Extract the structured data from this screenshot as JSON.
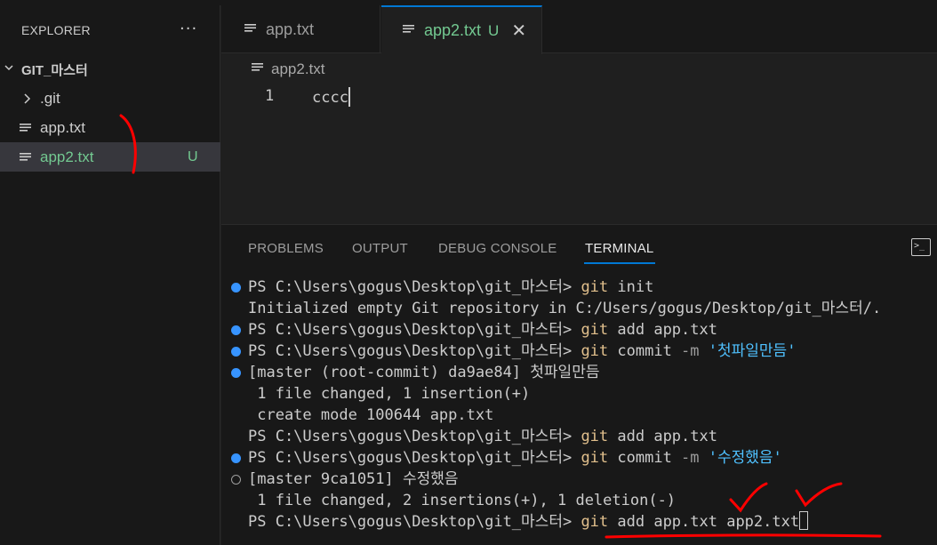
{
  "sidebar": {
    "title": "EXPLORER",
    "more_icon": "ellipsis-icon",
    "folder": "GIT_마스터",
    "items": [
      {
        "label": ".git",
        "icon": "chevron-right-icon"
      },
      {
        "label": "app.txt",
        "icon": "file-lines-icon"
      },
      {
        "label": "app2.txt",
        "icon": "file-lines-icon",
        "badge": "U"
      }
    ]
  },
  "tabs": [
    {
      "label": "app.txt"
    },
    {
      "label": "app2.txt",
      "badge": "U",
      "close": "✕"
    }
  ],
  "editor": {
    "breadcrumb": "app2.txt",
    "lines": [
      {
        "num": "1",
        "text": "cccc"
      }
    ]
  },
  "panel": {
    "tabs": [
      "PROBLEMS",
      "OUTPUT",
      "DEBUG CONSOLE",
      "TERMINAL"
    ],
    "active_tab": "TERMINAL"
  },
  "terminal": {
    "prompt": "PS C:\\Users\\gogus\\Desktop\\git_마스터> ",
    "l1_cmd": "git",
    "l1_args": " init",
    "l2": "Initialized empty Git repository in C:/Users/gogus/Desktop/git_마스터/.",
    "l3_cmd": "git",
    "l3_args": " add app.txt",
    "l4_cmd": "git",
    "l4_args": " commit ",
    "l4_flag": "-m",
    "l4_str": " '첫파일만듬'",
    "l5": "[master (root-commit) da9ae84] 첫파일만듬",
    "l6": " 1 file changed, 1 insertion(+)",
    "l7": " create mode 100644 app.txt",
    "l8_cmd": "git",
    "l8_args": " add app.txt",
    "l9_cmd": "git",
    "l9_args": " commit ",
    "l9_flag": "-m",
    "l9_str": " '수정했음'",
    "l10": "[master 9ca1051] 수정했음",
    "l11": " 1 file changed, 2 insertions(+), 1 deletion(-)",
    "l12_cmd": "git",
    "l12_args": " add app.txt app2.txt"
  },
  "colors": {
    "accent": "#0078d4",
    "untracked": "#73c991",
    "annotation": "#ff0000"
  }
}
